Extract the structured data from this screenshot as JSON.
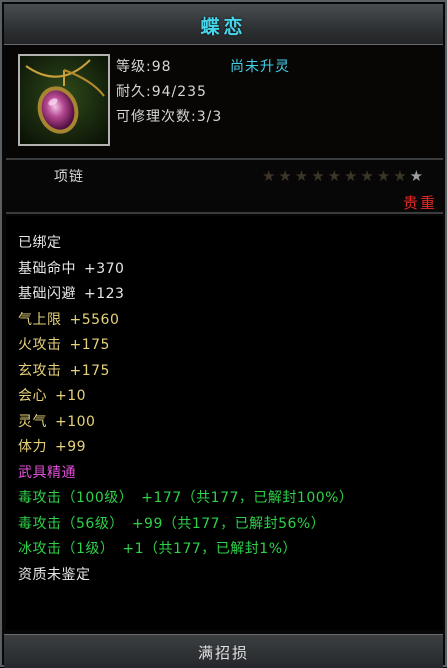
{
  "item": {
    "name": "蝶恋",
    "icon": "pendant-amethyst-icon",
    "level_label": "等级:98",
    "durability_label": "耐久:94/235",
    "repair_label": "可修理次数:3/3",
    "soul_status": "尚未升灵",
    "type": "项链",
    "star_rating": {
      "filled": 0,
      "total": 9,
      "indicator": 1
    },
    "rarity": "贵重"
  },
  "attributes": [
    {
      "name": "已绑定",
      "value": "",
      "color": "#e6e6e6"
    },
    {
      "name": "基础命中",
      "value": "+370",
      "color": "#e6e6e6"
    },
    {
      "name": "基础闪避",
      "value": "+123",
      "color": "#e6e6e6"
    },
    {
      "name": "气上限",
      "value": "+5560",
      "color": "#e6d27a"
    },
    {
      "name": "火攻击",
      "value": "+175",
      "color": "#e6d27a"
    },
    {
      "name": "玄攻击",
      "value": "+175",
      "color": "#e6d27a"
    },
    {
      "name": "会心",
      "value": "+10",
      "color": "#e6d27a"
    },
    {
      "name": "灵气",
      "value": "+100",
      "color": "#e6d27a"
    },
    {
      "name": "体力",
      "value": "+99",
      "color": "#e6d27a"
    },
    {
      "name": "武具精通",
      "value": "",
      "color": "#e34ed8"
    },
    {
      "name": "毒攻击（100级）",
      "value": "+177（共177，已解封100%）",
      "color": "#2fd04a"
    },
    {
      "name": "毒攻击（56级）",
      "value": "+99（共177，已解封56%）",
      "color": "#2fd04a"
    },
    {
      "name": "冰攻击（1级）",
      "value": "+1（共177，已解封1%）",
      "color": "#2fd04a"
    },
    {
      "name": "资质未鉴定",
      "value": "",
      "color": "#e6e6e6"
    }
  ],
  "footer": {
    "label": "满招损"
  }
}
